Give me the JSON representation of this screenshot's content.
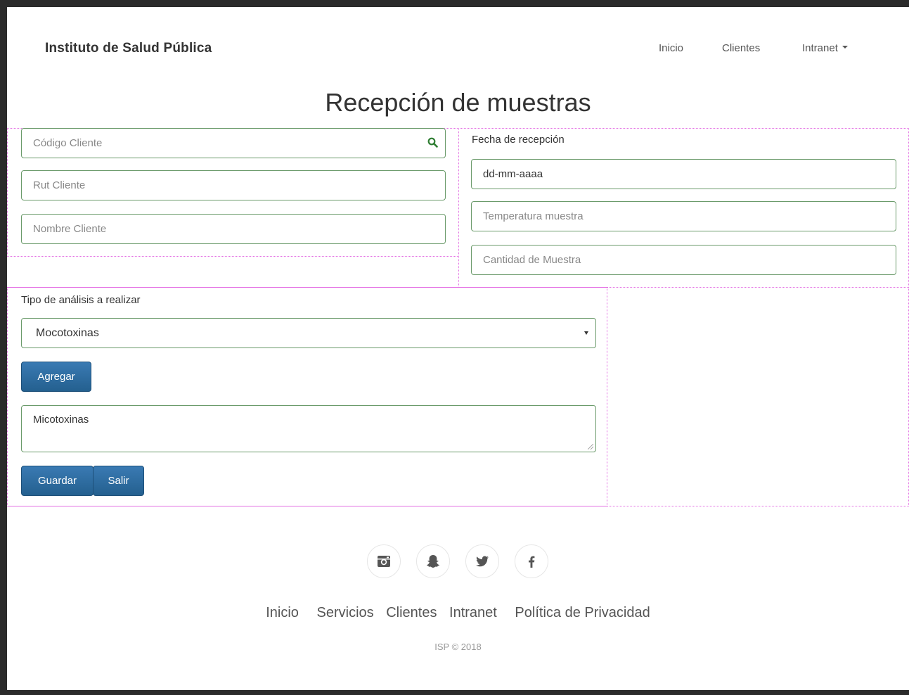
{
  "navbar": {
    "brand": "Instituto de Salud Pública",
    "links": {
      "inicio": "Inicio",
      "clientes": "Clientes",
      "intranet": "Intranet"
    }
  },
  "page_title": "Recepción de muestras",
  "client": {
    "codigo_placeholder": "Código Cliente",
    "rut_placeholder": "Rut Cliente",
    "nombre_placeholder": "Nombre Cliente"
  },
  "sample": {
    "fecha_label": "Fecha de recepción",
    "fecha_value": "dd-mm-aaaa",
    "temperatura_placeholder": "Temperatura muestra",
    "cantidad_placeholder": "Cantidad de Muestra"
  },
  "analysis": {
    "label": "Tipo de análisis a realizar",
    "selected": "Mocotoxinas",
    "add_button": "Agregar",
    "textarea_value": "Micotoxinas",
    "save_button": "Guardar",
    "exit_button": "Salir"
  },
  "footer": {
    "social_icons": [
      "instagram-icon",
      "snapchat-icon",
      "twitter-icon",
      "facebook-icon"
    ],
    "links": {
      "inicio": "Inicio",
      "servicios": "Servicios",
      "clientes": "Clientes",
      "intranet": "Intranet",
      "privacidad": "Política de Privacidad"
    },
    "copyright": "ISP © 2018"
  },
  "colors": {
    "button": "#24608f",
    "field_border": "#6a9a6a",
    "debug_outline": "#e36ee3"
  }
}
